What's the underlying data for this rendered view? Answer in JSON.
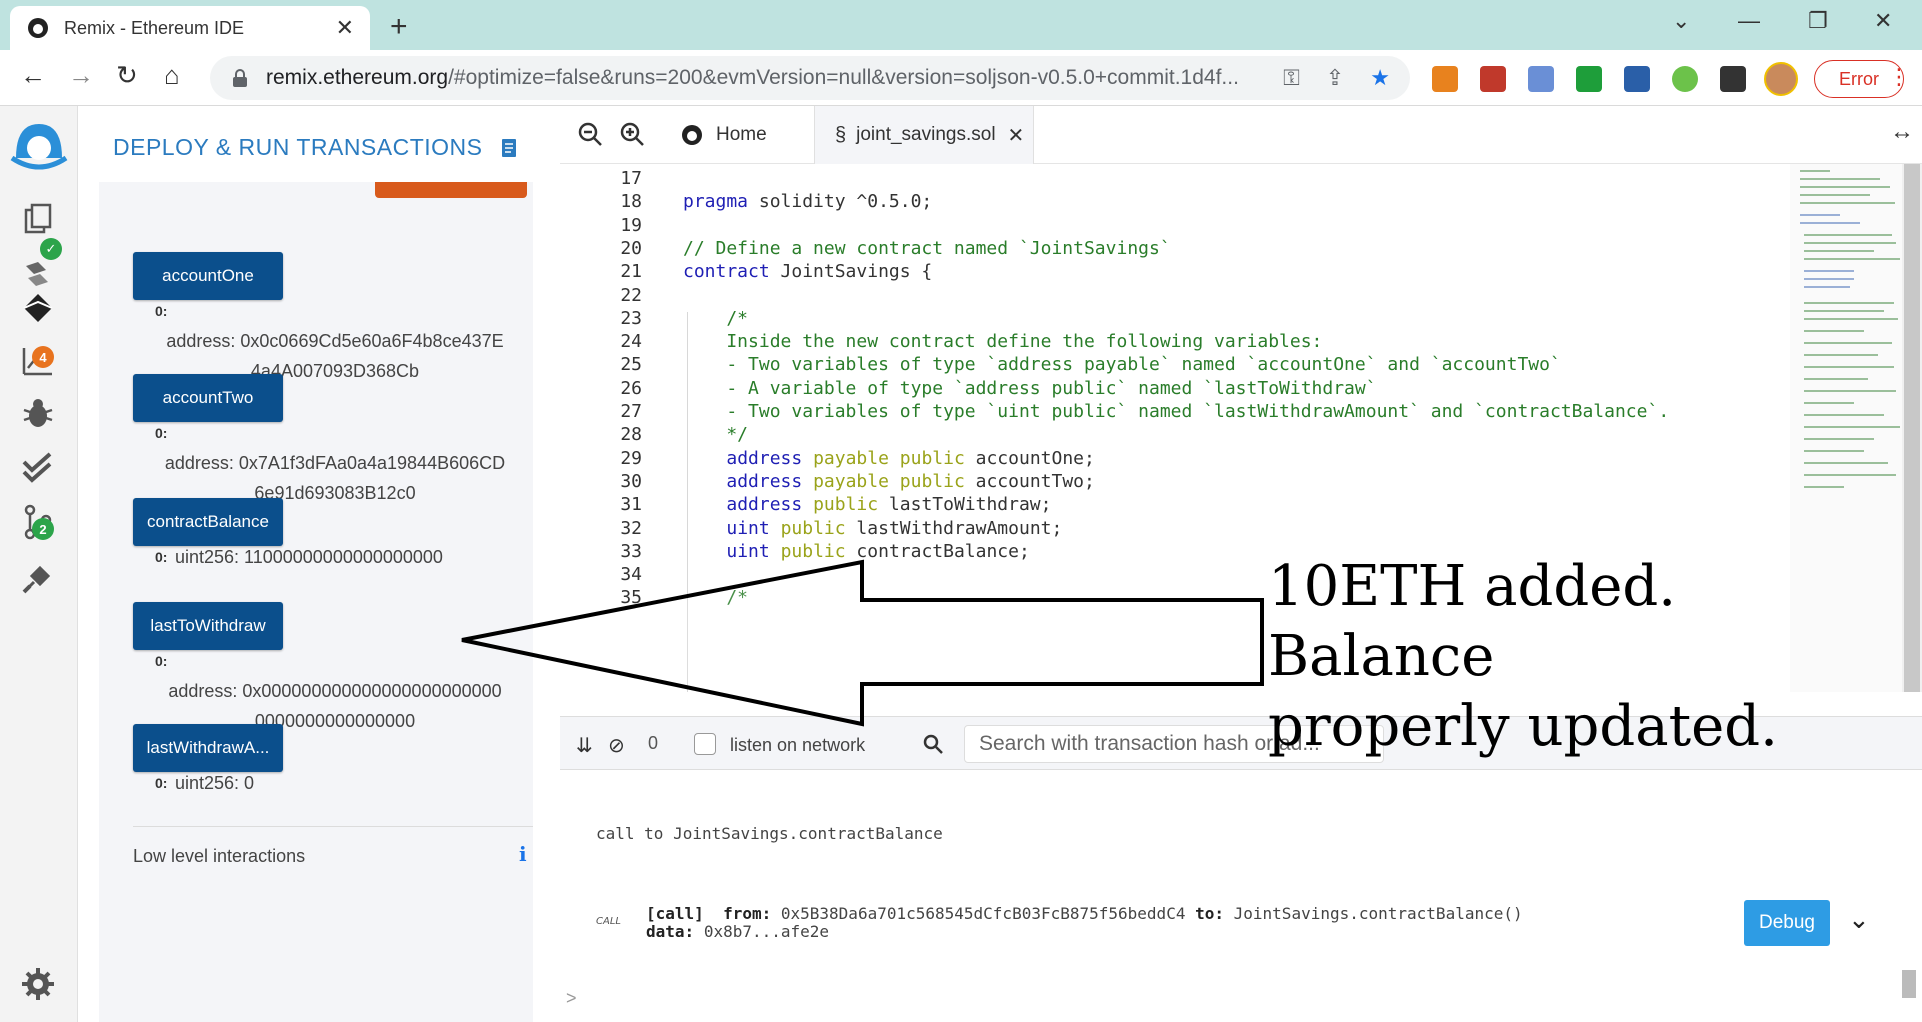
{
  "browser": {
    "tab_title": "Remix - Ethereum IDE",
    "url_host": "remix.ethereum.org",
    "url_rest": "/#optimize=false&runs=200&evmVersion=null&version=soljson-v0.5.0+commit.1d4f...",
    "error_label": "Error"
  },
  "sidepanel": {
    "title": "DEPLOY & RUN TRANSACTIONS",
    "functions": [
      {
        "label": "accountOne",
        "index": "0:",
        "value": "address: 0x0c0669Cd5e60a6F4b8ce437E",
        "value2": "4a4A007093D368Cb"
      },
      {
        "label": "accountTwo",
        "index": "0:",
        "value": "address: 0x7A1f3dFAa0a4a19844B606CD",
        "value2": "6e91d693083B12c0"
      },
      {
        "label": "contractBalance",
        "index": "0:",
        "value": "uint256: 11000000000000000000"
      },
      {
        "label": "lastToWithdraw",
        "index": "0:",
        "value": "address: 0x000000000000000000000000",
        "value2": "0000000000000000"
      },
      {
        "label": "lastWithdrawA...",
        "index": "0:",
        "value": "uint256: 0"
      }
    ],
    "low_level": "Low level interactions",
    "badges": {
      "analysis": "4",
      "git": "2"
    }
  },
  "editor": {
    "tabs": [
      {
        "label": "Home"
      },
      {
        "label": "joint_savings.sol"
      }
    ],
    "lines": [
      {
        "n": "17",
        "text": ""
      },
      {
        "n": "18",
        "text": "pragma solidity ^0.5.0;"
      },
      {
        "n": "19",
        "text": ""
      },
      {
        "n": "20",
        "text": "// Define a new contract named `JointSavings`"
      },
      {
        "n": "21",
        "text": "contract JointSavings {"
      },
      {
        "n": "22",
        "text": ""
      },
      {
        "n": "23",
        "text": "    /*"
      },
      {
        "n": "24",
        "text": "    Inside the new contract define the following variables:"
      },
      {
        "n": "25",
        "text": "    - Two variables of type `address payable` named `accountOne` and `accountTwo`"
      },
      {
        "n": "26",
        "text": "    - A variable of type `address public` named `lastToWithdraw`"
      },
      {
        "n": "27",
        "text": "    - Two variables of type `uint public` named `lastWithdrawAmount` and `contractBalance`."
      },
      {
        "n": "28",
        "text": "    */"
      },
      {
        "n": "29",
        "text": "    address payable public accountOne;"
      },
      {
        "n": "30",
        "text": "    address payable public accountTwo;"
      },
      {
        "n": "31",
        "text": "    address public lastToWithdraw;"
      },
      {
        "n": "32",
        "text": "    uint public lastWithdrawAmount;"
      },
      {
        "n": "33",
        "text": "    uint public contractBalance;"
      },
      {
        "n": "34",
        "text": ""
      },
      {
        "n": "35",
        "text": "    /*"
      }
    ]
  },
  "terminal": {
    "count": "0",
    "listen_label": "listen on network",
    "search_placeholder": "Search with transaction hash or ad...",
    "call_line": "call to JointSavings.contractBalance",
    "call_tag": "CALL",
    "call_kw": "[call]",
    "from_label": "from:",
    "from_value": "0x5B38Da6a701c568545dCfcB03FcB875f56beddC4",
    "to_label": "to:",
    "to_value": "JointSavings.contractBalance()",
    "data_label": "data:",
    "data_value": "0x8b7...afe2e",
    "debug_label": "Debug",
    "prompt": ">"
  },
  "annotation": {
    "line1": "10ETH added. Balance",
    "line2": "properly updated."
  },
  "colors": {
    "remix_blue": "#2b7bbf",
    "button_navy": "#0b4f8c",
    "debug_blue": "#2e9ce4",
    "error_red": "#d93025"
  }
}
